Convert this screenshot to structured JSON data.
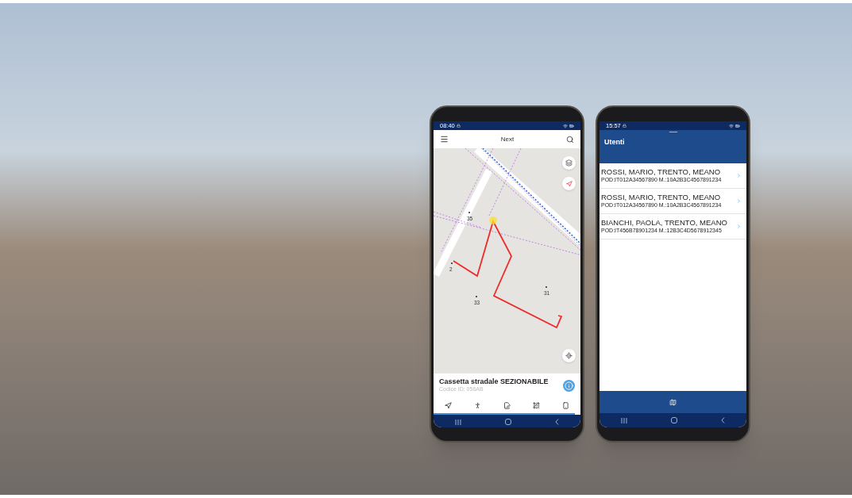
{
  "map_phone": {
    "status_time": "08:40",
    "app_bar": {
      "title": "Next"
    },
    "map": {
      "house_numbers": [
        "35",
        "2",
        "33",
        "31"
      ]
    },
    "feature_card": {
      "title": "Cassetta stradale SEZIONABILE",
      "subtitle": "Codice ID: 056AB"
    }
  },
  "list_phone": {
    "status_time": "15:57",
    "header": {
      "title": "Utenti"
    },
    "users": [
      {
        "name": "ROSSI, MARIO, TRENTO, MEANO",
        "detail": "POD:IT012A34567890 M.:10A2B3C4567891234"
      },
      {
        "name": "ROSSI, MARIO, TRENTO, MEANO",
        "detail": "POD:IT012A34567890 M.:10A2B3C4567891234"
      },
      {
        "name": "BIANCHI, PAOLA, TRENTO, MEANO",
        "detail": "POD:IT456B78901234 M.:12B3C4D5678912345"
      }
    ]
  }
}
